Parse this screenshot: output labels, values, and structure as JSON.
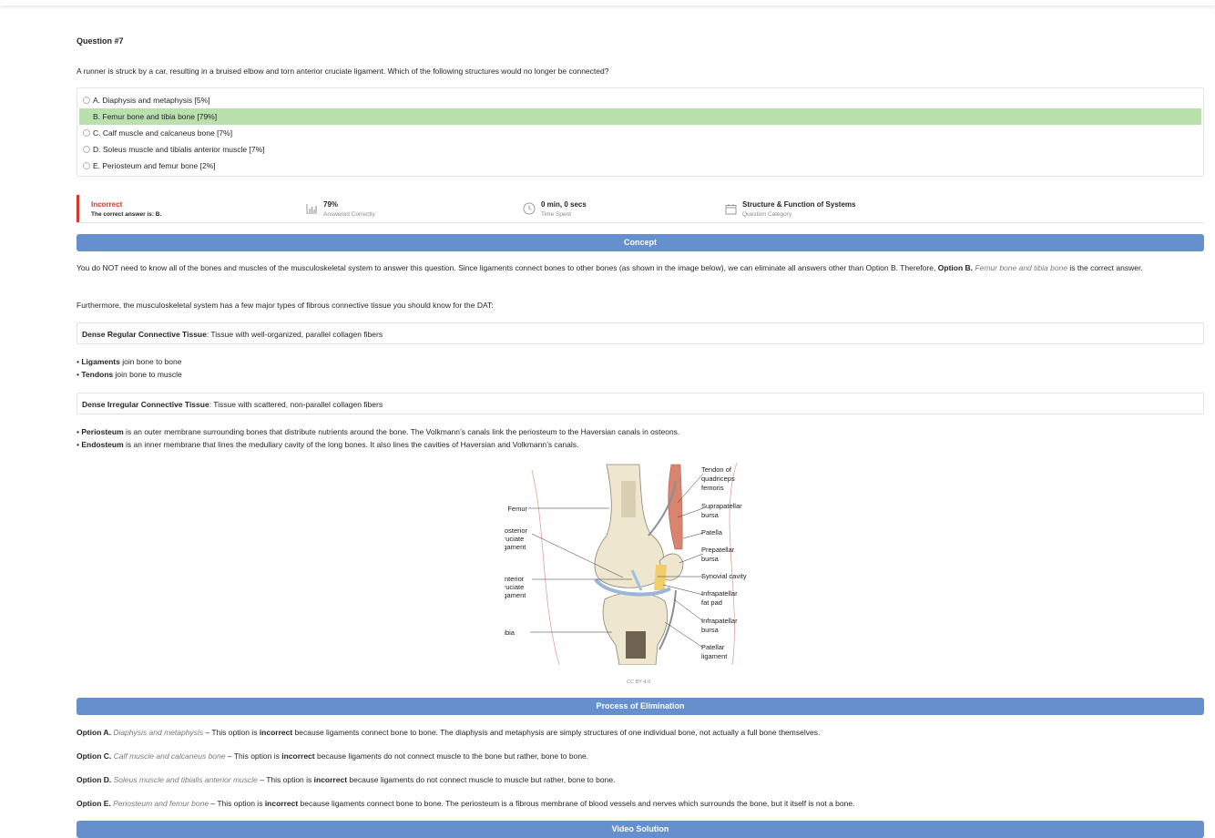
{
  "question": {
    "number": "Question #7",
    "text": "A runner is struck by a car, resulting in a bruised elbow and torn anterior cruciate ligament. Which of the following structures would no longer be connected?",
    "options": [
      {
        "label": "A. Diaphysis and metaphysis [5%]",
        "correct": false
      },
      {
        "label": "B. Femur bone and tibia bone [79%]",
        "correct": true
      },
      {
        "label": "C. Calf muscle and calcaneus bone [7%]",
        "correct": false
      },
      {
        "label": "D. Soleus muscle and tibialis anterior muscle [7%]",
        "correct": false
      },
      {
        "label": "E. Periosteum and femur bone [2%]",
        "correct": false
      }
    ]
  },
  "stats": {
    "result": "Incorrect",
    "correct_answer": "The correct answer is: B.",
    "percent": "79%",
    "percent_label": "Answered Correctly",
    "time": "0 min, 0 secs",
    "time_label": "Time Spent",
    "category": "Structure & Function of Systems",
    "category_label": "Question Category"
  },
  "concept": {
    "header": "Concept",
    "p1_start": "You do NOT need to know all of the bones and muscles of the musculoskeletal system to answer this question. Since ligaments connect bones to other bones (as shown in the image below), we can eliminate all answers other than Option B. Therefore,",
    "p1_bold": "Option B.",
    "p1_italic": "Femur bone and tibia bone",
    "p1_end": "is the correct answer.",
    "p2": "Furthermore, the musculoskeletal system has a few major types of fibrous connective tissue you should know for the DAT:",
    "box1_bold": "Dense Regular Connective Tissue",
    "box1_rest": ": Tissue with well-organized, parallel collagen fibers",
    "b1_bold": "Ligaments",
    "b1_rest": " join bone to bone",
    "b2_bold": "Tendons",
    "b2_rest": " join bone to muscle",
    "box2_bold": "Dense Irregular Connective Tissue",
    "box2_rest": ": Tissue with scattered, non-parallel collagen fibers",
    "b3_bold": "Periosteum",
    "b3_rest": " is an outer membrane surrounding bones that distribute nutrients around the bone. The Volkmann’s canals link the periosteum to the Haversian canals in osteons.",
    "b4_bold": "Endosteum",
    "b4_rest": " is an inner membrane that lines the medullary cavity of the long bones. It also lines the cavities of Haversian and Volkmann’s canals.",
    "bullet": "•"
  },
  "figure": {
    "left_labels": [
      "Femur",
      "Posterior",
      "cruciate",
      "ligament",
      "Anterior",
      "cruciate",
      "ligament",
      "Tibia"
    ],
    "right_labels": [
      "Tendon of",
      "quadriceps",
      "femoris",
      "Suprapatellar",
      "bursa",
      "Patella",
      "Prepatellar",
      "bursa",
      "Synovial cavity",
      "Infrapatellar",
      "fat pad",
      "Infrapatellar",
      "bursa",
      "Patellar",
      "ligament"
    ],
    "credit": "CC BY 4.0"
  },
  "elimination": {
    "header": "Process of Elimination",
    "items": [
      {
        "opt": "Option A.",
        "name": "Diaphysis and metaphysis",
        "pre": " – This option is ",
        "bold": "incorrect",
        "post": " because ligaments connect bone to bone. The diaphysis and metaphysis are simply structures of one individual bone, not actually a full bone themselves."
      },
      {
        "opt": "Option C.",
        "name": "Calf muscle and calcaneus bone",
        "pre": " – This option is ",
        "bold": "incorrect",
        "post": " because ligaments do not connect muscle to the bone but rather, bone to bone."
      },
      {
        "opt": "Option D.",
        "name": "Soleus muscle and tibialis anterior muscle",
        "pre": " – This option is ",
        "bold": "incorrect",
        "post": " because ligaments do not connect muscle to muscle but rather, bone to bone."
      },
      {
        "opt": "Option E.",
        "name": "Periosteum and femur bone",
        "pre": " – This option is ",
        "bold": "incorrect",
        "post": " because ligaments connect bone to bone. The periosteum is a fibrous membrane of blood vessels and nerves which surrounds the bone, but it itself is not a bone."
      }
    ]
  },
  "video": {
    "header": "Video Solution"
  },
  "colors": {
    "band": "#6590cd",
    "correct_highlight": "#b9e0ad",
    "incorrect": "#d9362b"
  }
}
